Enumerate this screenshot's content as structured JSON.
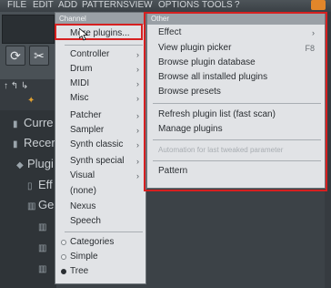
{
  "menubar": {
    "items": [
      "FILE",
      "EDIT",
      "ADD",
      "PATTERNS",
      "VIEW",
      "OPTIONS",
      "TOOLS",
      "?"
    ]
  },
  "background_browser": {
    "items": [
      {
        "icon": "folder-icon",
        "label": "Curre"
      },
      {
        "icon": "folder-icon",
        "label": "Recer"
      },
      {
        "icon": "plugin-icon",
        "label": "Plugi"
      },
      {
        "icon": "plugin-icon",
        "label": "Eff"
      },
      {
        "icon": "plugin-icon",
        "label": "Ge"
      },
      {
        "icon": "plugin-icon",
        "label": ""
      },
      {
        "icon": "plugin-icon",
        "label": ""
      },
      {
        "icon": "plugin-icon",
        "label": ""
      },
      {
        "icon": "plugin-icon",
        "label": ""
      }
    ]
  },
  "add_menu": {
    "left": {
      "header": "Channel",
      "more_plugins": "More plugins...",
      "submenus": [
        "Controller",
        "Drum",
        "MIDI",
        "Misc",
        "Patcher",
        "Sampler",
        "Synth classic",
        "Synth special",
        "Visual"
      ],
      "plain_items": [
        "(none)",
        "Nexus",
        "Speech"
      ],
      "view_modes": [
        "Categories",
        "Simple",
        "Tree"
      ],
      "selected_view_mode": "Tree",
      "submenu_arrow": "›"
    },
    "right": {
      "header": "Other",
      "effect": "Effect",
      "view_plugin_picker": "View plugin picker",
      "view_plugin_picker_shortcut": "F8",
      "browse_plugin_database": "Browse plugin database",
      "browse_all_installed": "Browse all installed plugins",
      "browse_presets": "Browse presets",
      "refresh_plugin_list": "Refresh plugin list (fast scan)",
      "manage_plugins": "Manage plugins",
      "automation_last_tweaked": "Automation for last tweaked parameter",
      "pattern": "Pattern"
    }
  },
  "colors": {
    "menu_bg": "#e1e3e6",
    "header_bg": "#9aa0a6",
    "highlight": "#d62020",
    "app_bg": "#3c4247"
  }
}
